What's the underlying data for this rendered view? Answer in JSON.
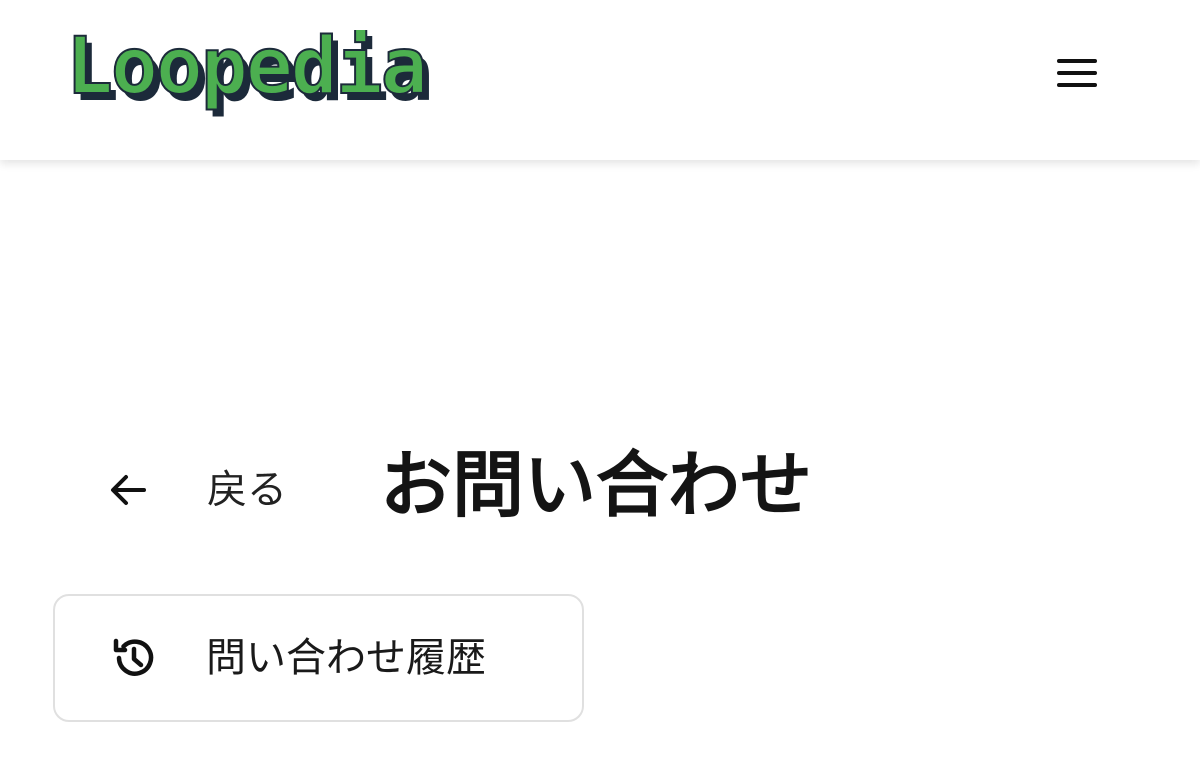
{
  "header": {
    "logo_text": "Loopedia",
    "menu_icon": "hamburger-menu-icon"
  },
  "nav": {
    "back_label": "戻る",
    "back_icon": "arrow-left-icon"
  },
  "page": {
    "title": "お問い合わせ"
  },
  "history_button": {
    "label": "問い合わせ履歴",
    "icon": "history-clock-icon"
  },
  "colors": {
    "logo_green": "#4caf50",
    "logo_shadow": "#1c2a3a",
    "button_border": "#e0e0e0",
    "text": "#111111"
  }
}
